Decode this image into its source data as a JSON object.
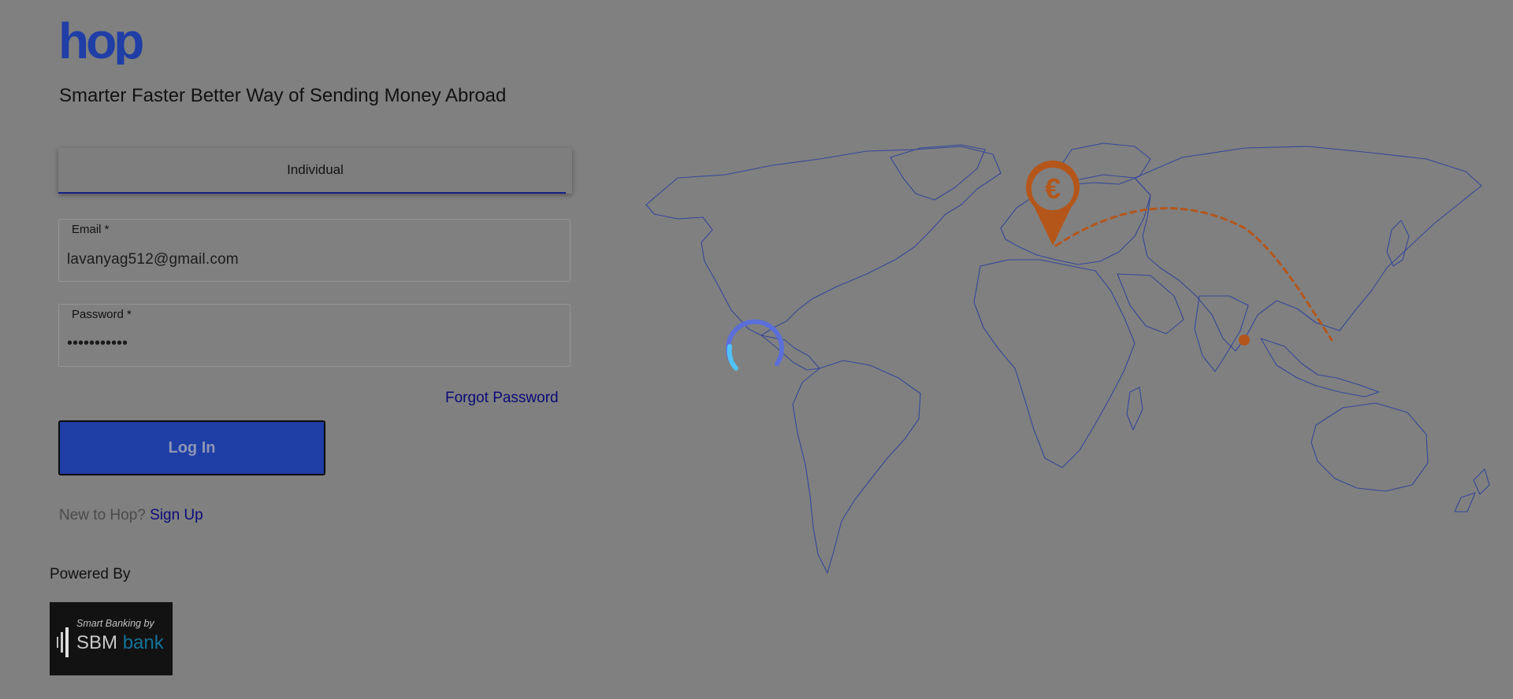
{
  "brand": {
    "logo_text": "hop",
    "color": "#1f3ea6"
  },
  "tagline": "Smarter Faster Better Way of Sending Money Abroad",
  "tabs": [
    {
      "label": "Individual",
      "selected": true
    }
  ],
  "form": {
    "email": {
      "label": "Email *",
      "value": "lavanyag512@gmail.com"
    },
    "password": {
      "label": "Password *",
      "value": "•••••••••••"
    }
  },
  "forgot_password": "Forgot Password",
  "login_button": "Log In",
  "signup": {
    "prompt": "New to Hop?",
    "link": "Sign Up"
  },
  "powered_by": {
    "label": "Powered By",
    "partner_tagline": "Smart Banking by",
    "partner_name": "SBM",
    "partner_suffix": "bank"
  },
  "map": {
    "pin_symbol": "€",
    "accent_color": "#b4561a",
    "outline_color": "#34479a"
  },
  "loading": {
    "spinner_colors": [
      "#5b6fd8",
      "#4fc3f7"
    ]
  }
}
